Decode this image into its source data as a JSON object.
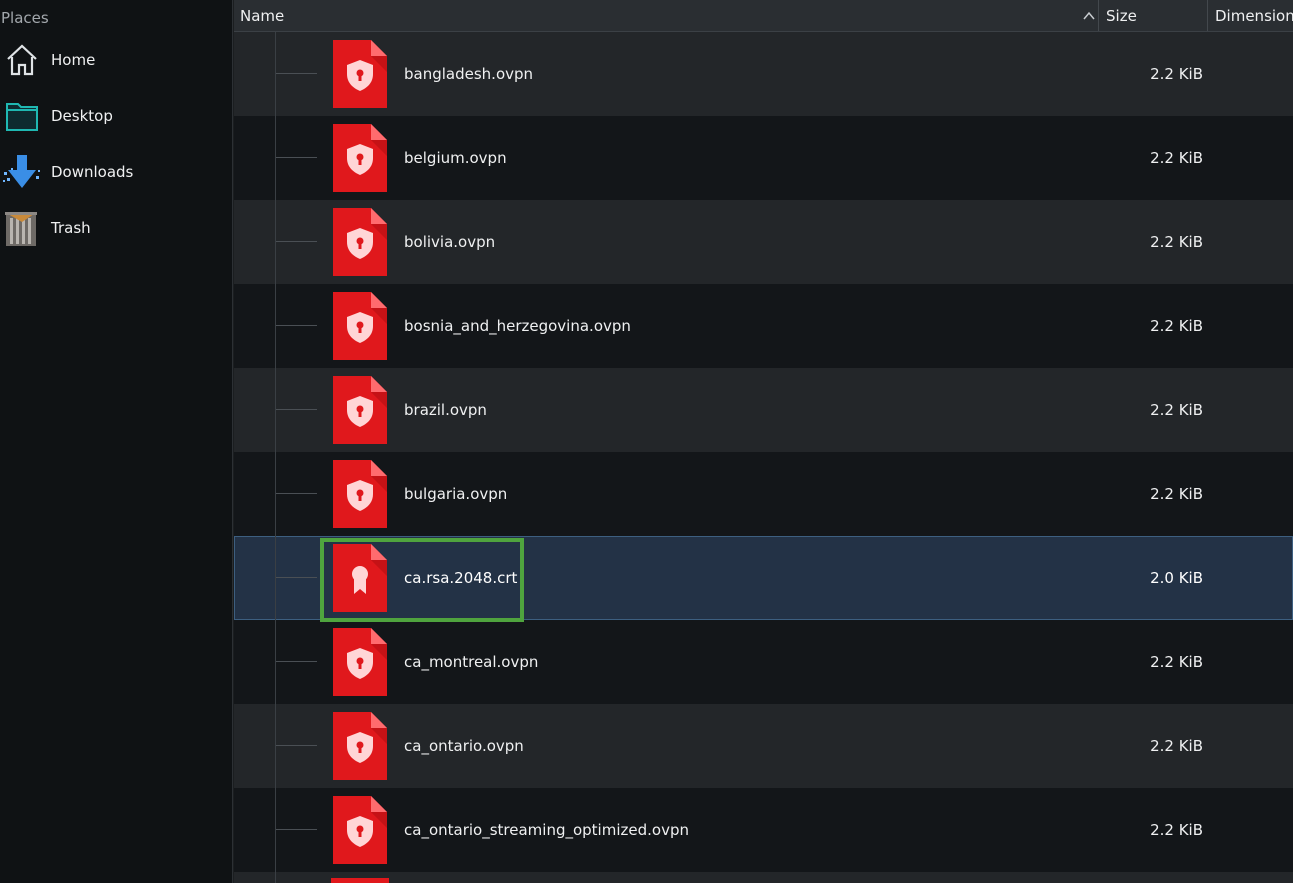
{
  "sidebar": {
    "header": "Places",
    "items": [
      {
        "label": "Home",
        "icon": "home-icon"
      },
      {
        "label": "Desktop",
        "icon": "desktop-folder-icon"
      },
      {
        "label": "Downloads",
        "icon": "downloads-icon"
      },
      {
        "label": "Trash",
        "icon": "trash-icon"
      }
    ]
  },
  "columns": {
    "name": "Name",
    "size": "Size",
    "dimensions": "Dimension"
  },
  "files": [
    {
      "name": "bangladesh.ovpn",
      "size": "2.2 KiB",
      "icon": "vpn-shield-icon",
      "selected": false
    },
    {
      "name": "belgium.ovpn",
      "size": "2.2 KiB",
      "icon": "vpn-shield-icon",
      "selected": false
    },
    {
      "name": "bolivia.ovpn",
      "size": "2.2 KiB",
      "icon": "vpn-shield-icon",
      "selected": false
    },
    {
      "name": "bosnia_and_herzegovina.ovpn",
      "size": "2.2 KiB",
      "icon": "vpn-shield-icon",
      "selected": false
    },
    {
      "name": "brazil.ovpn",
      "size": "2.2 KiB",
      "icon": "vpn-shield-icon",
      "selected": false
    },
    {
      "name": "bulgaria.ovpn",
      "size": "2.2 KiB",
      "icon": "vpn-shield-icon",
      "selected": false
    },
    {
      "name": "ca.rsa.2048.crt",
      "size": "2.0 KiB",
      "icon": "certificate-icon",
      "selected": true
    },
    {
      "name": "ca_montreal.ovpn",
      "size": "2.2 KiB",
      "icon": "vpn-shield-icon",
      "selected": false
    },
    {
      "name": "ca_ontario.ovpn",
      "size": "2.2 KiB",
      "icon": "vpn-shield-icon",
      "selected": false
    },
    {
      "name": "ca_ontario_streaming_optimized.ovpn",
      "size": "2.2 KiB",
      "icon": "vpn-shield-icon",
      "selected": false
    }
  ],
  "colors": {
    "file_icon_red": "#e0181c",
    "selection": "#233246",
    "highlight_box": "#4fa43e"
  }
}
